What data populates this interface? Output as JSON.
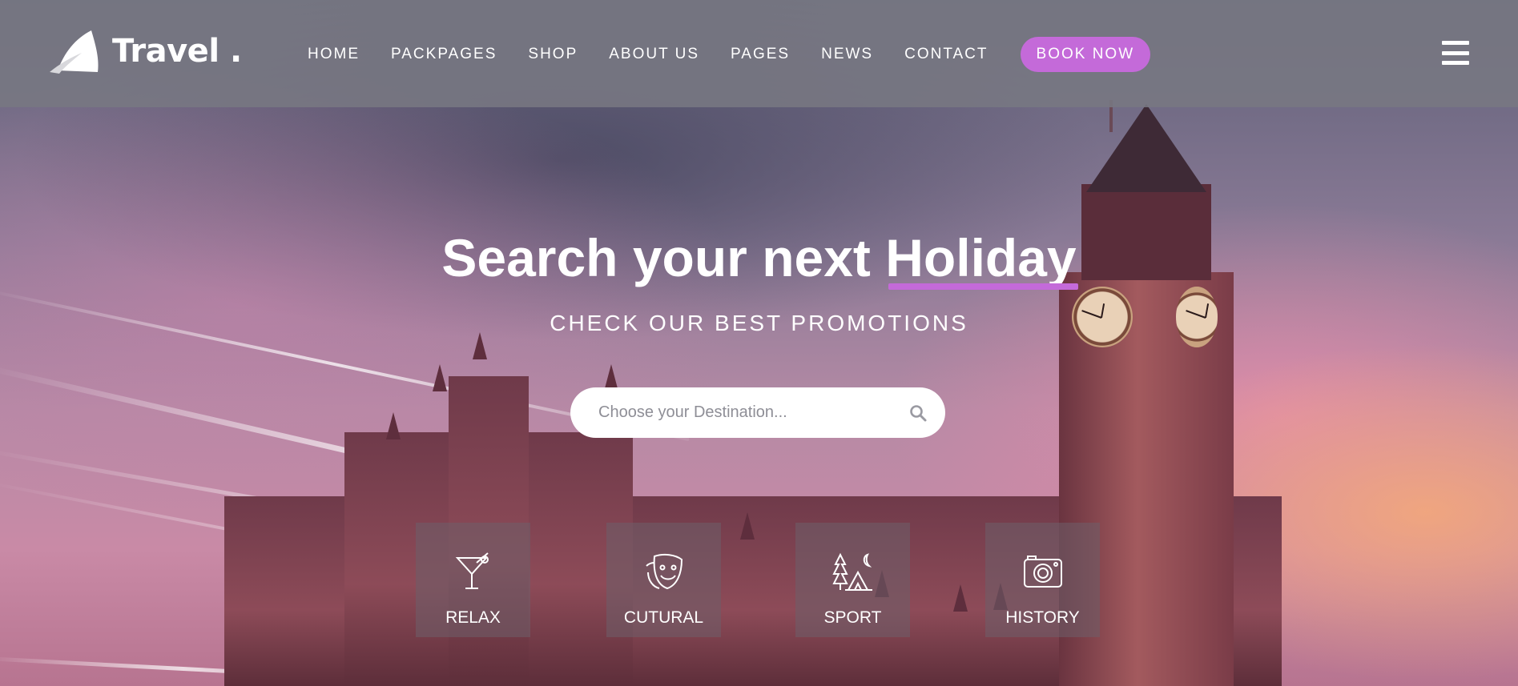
{
  "brand": {
    "name": "Travel",
    "dot": "."
  },
  "nav": {
    "items": [
      {
        "label": "HOME"
      },
      {
        "label": "PACKPAGES"
      },
      {
        "label": "SHOP"
      },
      {
        "label": "ABOUT US"
      },
      {
        "label": "PAGES"
      },
      {
        "label": "NEWS"
      },
      {
        "label": "CONTACT"
      }
    ],
    "cta_label": "BOOK NOW"
  },
  "hero": {
    "headline_prefix": "Search your next",
    "headline_highlight": "Holiday",
    "subheadline": "CHECK OUR BEST PROMOTIONS"
  },
  "search": {
    "placeholder": "Choose your Destination...",
    "icon": "search-icon"
  },
  "categories": [
    {
      "label": "RELAX",
      "icon": "cocktail-icon"
    },
    {
      "label": "CUTURAL",
      "icon": "theater-mask-icon"
    },
    {
      "label": "SPORT",
      "icon": "camping-icon"
    },
    {
      "label": "HISTORY",
      "icon": "camera-icon"
    }
  ],
  "colors": {
    "accent": "#c46ad9",
    "header_bg": "#78787f",
    "text": "#ffffff"
  }
}
